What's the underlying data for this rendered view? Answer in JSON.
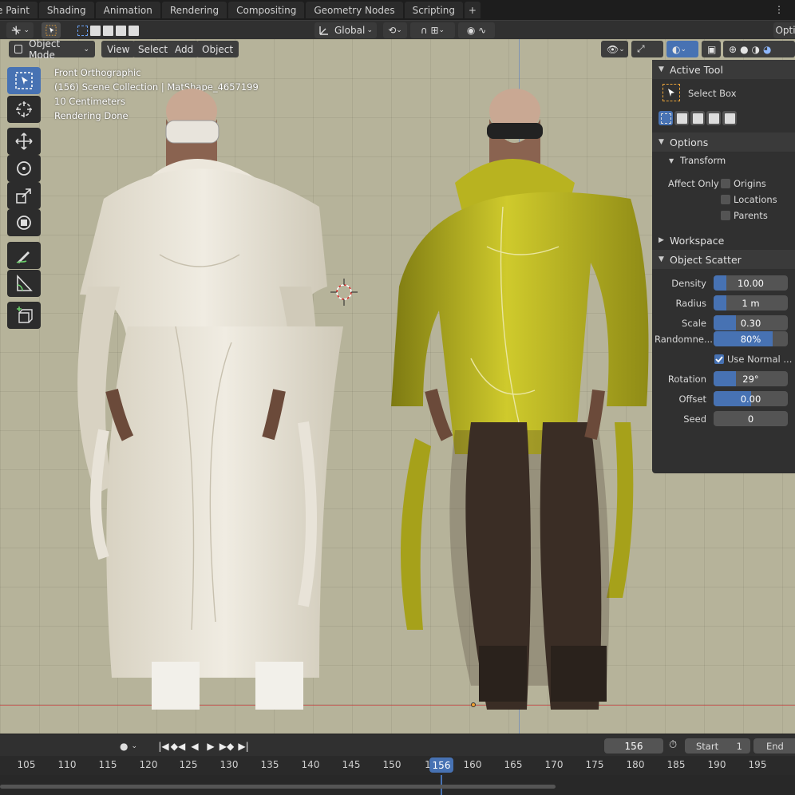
{
  "workspace_tabs": [
    "e Paint",
    "Shading",
    "Animation",
    "Rendering",
    "Compositing",
    "Geometry Nodes",
    "Scripting"
  ],
  "topbar_right": "Opti",
  "header": {
    "transform_orientation": "Global"
  },
  "viewport_header": {
    "mode": "Object Mode",
    "menus": [
      "View",
      "Select",
      "Add",
      "Object"
    ]
  },
  "overlay": {
    "view_name": "Front Orthographic",
    "collection": "(156) Scene Collection | MatShape_4657199",
    "scale": "10 Centimeters",
    "status": "Rendering Done"
  },
  "npanel": {
    "active_tool_title": "Active Tool",
    "tool_name": "Select Box",
    "options_title": "Options",
    "transform_title": "Transform",
    "affect_only_label": "Affect Only",
    "affect_options": [
      "Origins",
      "Locations",
      "Parents"
    ],
    "workspace_title": "Workspace",
    "scatter_title": "Object Scatter",
    "density_label": "Density",
    "density_value": "10.00",
    "density_fill": 0.17,
    "radius_label": "Radius",
    "radius_value": "1 m",
    "radius_fill": 0.17,
    "scale_label": "Scale",
    "scale_value": "0.30",
    "scale_fill": 0.3,
    "randomness_label": "Randomne...",
    "randomness_value": "80%",
    "randomness_fill": 0.8,
    "use_normal_label": "Use Normal ...",
    "rotation_label": "Rotation",
    "rotation_value": "29°",
    "rotation_fill": 0.3,
    "offset_label": "Offset",
    "offset_value": "0.00",
    "offset_fill": 0.5,
    "seed_label": "Seed",
    "seed_value": "0",
    "seed_fill": 0
  },
  "timeline": {
    "current_frame": "156",
    "start_label": "Start",
    "start_value": "1",
    "end_label": "End",
    "ticks": [
      "105",
      "110",
      "115",
      "120",
      "125",
      "130",
      "135",
      "140",
      "145",
      "150",
      "1",
      "160",
      "165",
      "170",
      "175",
      "180",
      "185",
      "190",
      "195"
    ],
    "playhead_label": "156"
  },
  "colors": {
    "accent": "#4772b3",
    "viewport_bg": "#b6b39a",
    "yellow_garment": "#b9b41e"
  }
}
